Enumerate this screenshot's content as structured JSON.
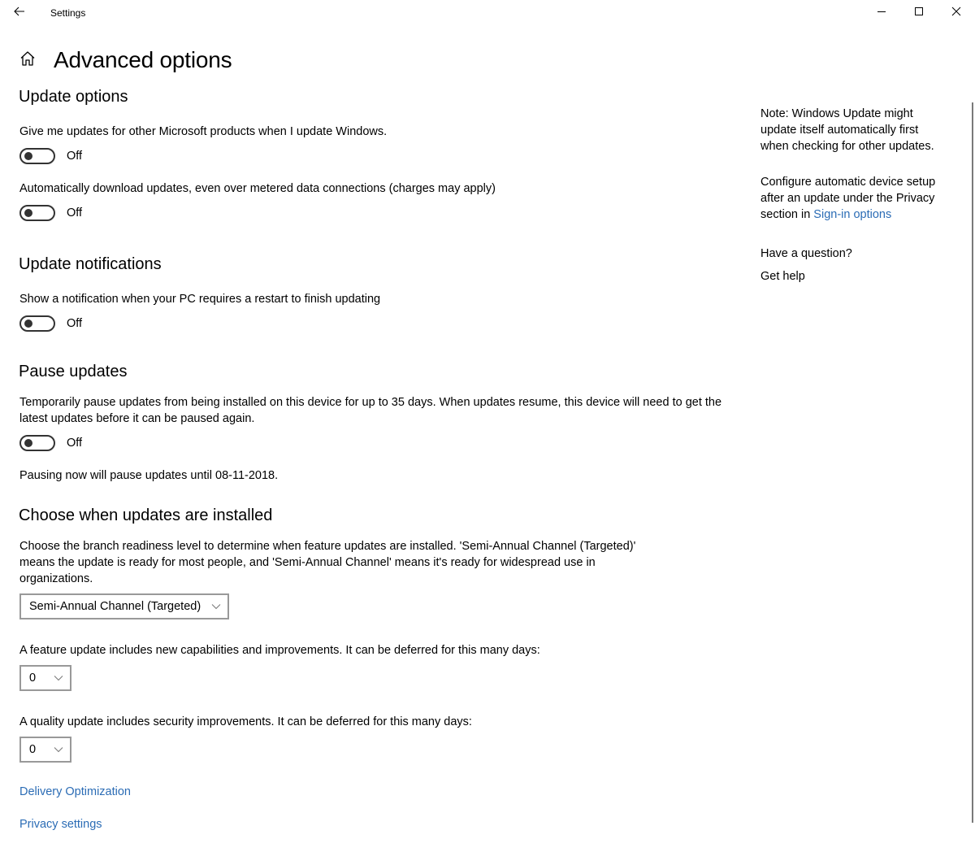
{
  "window": {
    "title": "Settings",
    "controls": {
      "minimize": "minimize",
      "maximize": "maximize",
      "close": "close"
    }
  },
  "icons": {
    "back": "back-arrow-icon",
    "home": "home-icon",
    "chevron": "chevron-down-icon"
  },
  "page": {
    "title": "Advanced options"
  },
  "update_options": {
    "title": "Update options",
    "items": [
      {
        "label": "Give me updates for other Microsoft products when I update Windows.",
        "state": "Off",
        "on": false
      },
      {
        "label": "Automatically download updates, even over metered data connections (charges may apply)",
        "state": "Off",
        "on": false
      }
    ]
  },
  "update_notifications": {
    "title": "Update notifications",
    "items": [
      {
        "label": "Show a notification when your PC requires a restart to finish updating",
        "state": "Off",
        "on": false
      }
    ]
  },
  "pause_updates": {
    "title": "Pause updates",
    "description": "Temporarily pause updates from being installed on this device for up to 35 days. When updates resume, this device will need to get the latest updates before it can be paused again.",
    "state": "Off",
    "on": false,
    "status": "Pausing now will pause updates until 08-11-2018."
  },
  "choose_when": {
    "title": "Choose when updates are installed",
    "description": "Choose the branch readiness level to determine when feature updates are installed. 'Semi-Annual Channel (Targeted)' means the update is ready for most people, and 'Semi-Annual Channel' means it's ready for widespread use in organizations.",
    "branch_select": {
      "value": "Semi-Annual Channel (Targeted)"
    },
    "feature_label": "A feature update includes new capabilities and improvements. It can be deferred for this many days:",
    "feature_select": {
      "value": "0"
    },
    "quality_label": "A quality update includes security improvements. It can be deferred for this many days:",
    "quality_select": {
      "value": "0"
    }
  },
  "links": {
    "delivery_optimization": "Delivery Optimization",
    "privacy_settings": "Privacy settings"
  },
  "sidebar": {
    "note": "Note: Windows Update might update itself automatically first when checking for other updates.",
    "configure_text": "Configure automatic device setup after an update under the Privacy section in",
    "configure_link": "Sign-in options",
    "question": "Have a question?",
    "help_link": "Get help"
  },
  "colors": {
    "link": "#2b6cb5",
    "toggle_off": "#333333",
    "dropdown_border": "#999999"
  }
}
